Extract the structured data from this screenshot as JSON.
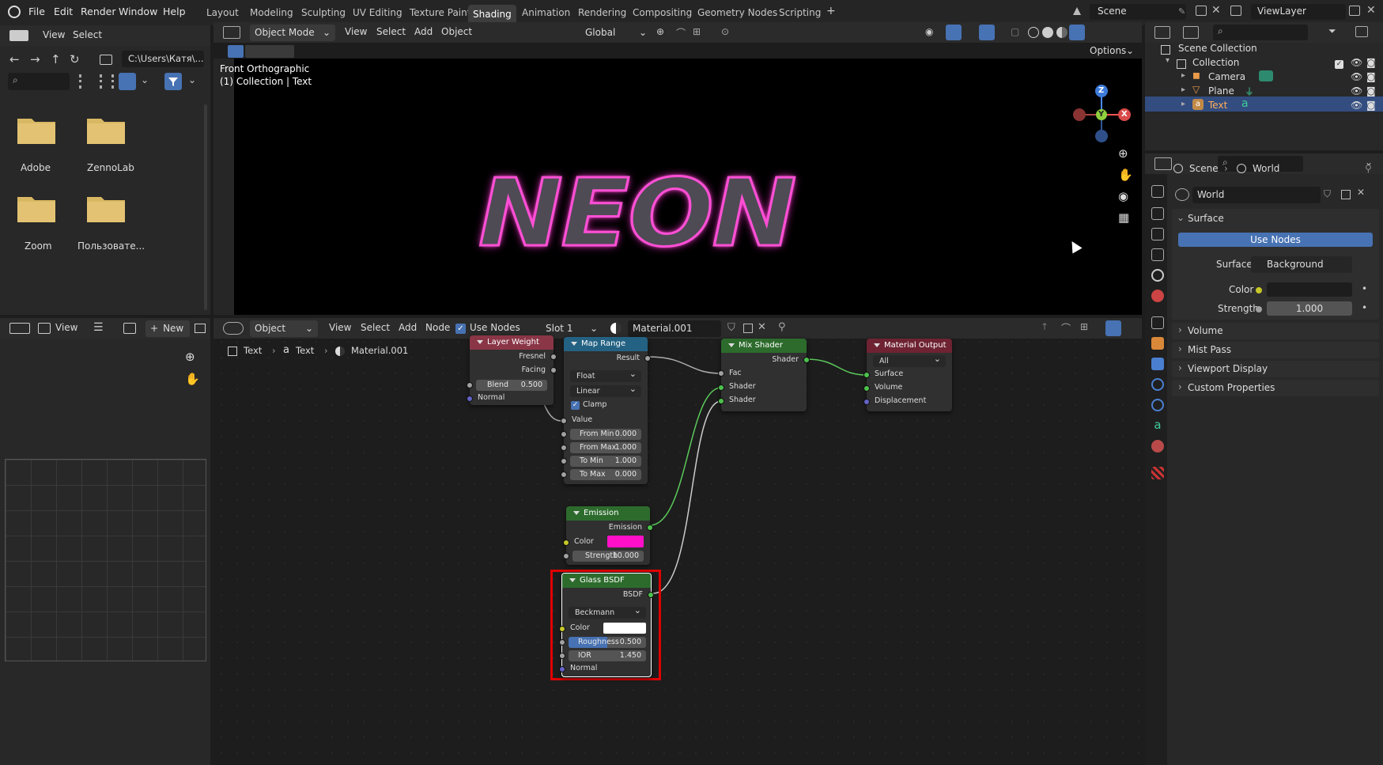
{
  "topbar": {
    "menus": [
      "File",
      "Edit",
      "Render",
      "Window",
      "Help"
    ],
    "workspaces": [
      "Layout",
      "Modeling",
      "Sculpting",
      "UV Editing",
      "Texture Paint",
      "Shading",
      "Animation",
      "Rendering",
      "Compositing",
      "Geometry Nodes",
      "Scripting"
    ],
    "active_workspace": "Shading",
    "add_tab": "+",
    "scene": "Scene",
    "view_layer": "ViewLayer"
  },
  "filebrowser": {
    "view": "View",
    "select": "Select",
    "path": "C:\\Users\\Катя\\...",
    "folders": [
      "Adobe",
      "ZennoLab",
      "Zoom",
      "Пользовате..."
    ]
  },
  "viewport": {
    "mode": "Object Mode",
    "menus": [
      "View",
      "Select",
      "Add",
      "Object"
    ],
    "orientation": "Global",
    "options": "Options",
    "overlay_line1": "Front Orthographic",
    "overlay_line2": "(1) Collection | Text",
    "neon_text": "NEON",
    "gizmo": {
      "z": "Z",
      "y": "Y",
      "x": "X"
    }
  },
  "image_editor": {
    "view": "View",
    "new": "New"
  },
  "node_editor": {
    "object": "Object",
    "menus": [
      "View",
      "Select",
      "Add",
      "Node"
    ],
    "use_nodes": "Use Nodes",
    "slot": "Slot 1",
    "material": "Material.001",
    "breadcrumb": [
      "Text",
      "Text",
      "Material.001"
    ]
  },
  "nodes": {
    "layer_weight": {
      "title": "Layer Weight",
      "out1": "Fresnel",
      "out2": "Facing",
      "blend_label": "Blend",
      "blend_value": "0.500",
      "normal": "Normal"
    },
    "map_range": {
      "title": "Map Range",
      "result": "Result",
      "type": "Float",
      "interp": "Linear",
      "clamp": "Clamp",
      "value": "Value",
      "fields": [
        {
          "label": "From Min",
          "value": "0.000"
        },
        {
          "label": "From Max",
          "value": "1.000"
        },
        {
          "label": "To Min",
          "value": "1.000"
        },
        {
          "label": "To Max",
          "value": "0.000"
        }
      ]
    },
    "mix_shader": {
      "title": "Mix Shader",
      "out": "Shader",
      "fac": "Fac",
      "in1": "Shader",
      "in2": "Shader"
    },
    "material_output": {
      "title": "Material Output",
      "target": "All",
      "surface": "Surface",
      "volume": "Volume",
      "displacement": "Displacement"
    },
    "emission": {
      "title": "Emission",
      "out": "Emission",
      "color": "Color",
      "color_value": "#ff10c8",
      "strength_label": "Strength",
      "strength_value": "10.000"
    },
    "glass": {
      "title": "Glass BSDF",
      "out": "BSDF",
      "distribution": "Beckmann",
      "color": "Color",
      "roughness_label": "Roughness",
      "roughness_value": "0.500",
      "roughness_fill": 0.5,
      "ior_label": "IOR",
      "ior_value": "1.450",
      "normal": "Normal"
    }
  },
  "outliner": {
    "scene_collection": "Scene Collection",
    "collection": "Collection",
    "items": [
      "Camera",
      "Plane",
      "Text"
    ],
    "selected": "Text"
  },
  "properties": {
    "breadcrumb_scene": "Scene",
    "breadcrumb_world": "World",
    "world_name": "World",
    "surface_panel": "Surface",
    "use_nodes": "Use Nodes",
    "surface_label": "Surface",
    "surface_value": "Background",
    "color_label": "Color",
    "strength_label": "Strength",
    "strength_value": "1.000",
    "panels": [
      "Volume",
      "Mist Pass",
      "Viewport Display",
      "Custom Properties"
    ]
  },
  "colors": {
    "accent_blue": "#4772b3",
    "neon_pink": "#ff10c8",
    "highlight_red": "#e00000"
  }
}
